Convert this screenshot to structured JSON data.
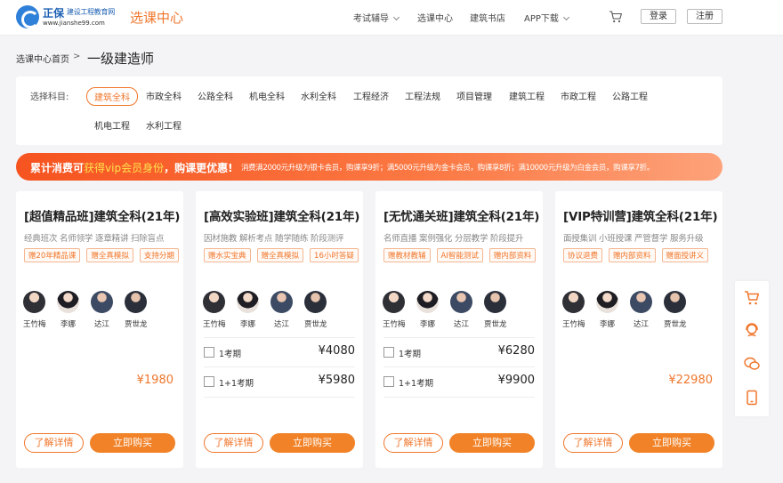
{
  "header": {
    "logo_brand": "正保",
    "logo_tagline": "建设工程教育网",
    "logo_url": "www.jianshe99.com",
    "section_title": "选课中心",
    "nav": [
      {
        "label": "考试辅导",
        "has_dropdown": true
      },
      {
        "label": "选课中心",
        "has_dropdown": false
      },
      {
        "label": "建筑书店",
        "has_dropdown": false
      },
      {
        "label": "APP下载",
        "has_dropdown": true
      }
    ],
    "login_label": "登录",
    "register_label": "注册"
  },
  "breadcrumb": {
    "home": "选课中心首页",
    "separator": ">",
    "current": "一级建造师"
  },
  "subjects": {
    "label": "选择科目:",
    "items": [
      "建筑全科",
      "市政全科",
      "公路全科",
      "机电全科",
      "水利全科",
      "工程经济",
      "工程法规",
      "项目管理",
      "建筑工程",
      "市政工程",
      "公路工程",
      "机电工程",
      "水利工程"
    ],
    "selected": "建筑全科"
  },
  "banner": {
    "main_prefix": "累计消费可",
    "main_highlight": "获得vip会员身份",
    "main_suffix": "，购课更优惠!",
    "sub": "消费满2000元升级为银卡会员，购课享9折；满5000元升级为金卡会员，购课享8折；满10000元升级为白金会员，购课享7折。"
  },
  "cards": [
    {
      "title": "[超值精品班]建筑全科(21年)",
      "desc": "经典班次 名师领学 逐章精讲 扫除盲点",
      "tags": [
        "赠20年精品课",
        "赠全真模拟",
        "支持分期"
      ],
      "teachers": [
        "王竹梅",
        "李娜",
        "达江",
        "贾世龙"
      ],
      "price": "¥1980",
      "options": [],
      "detail_label": "了解详情",
      "buy_label": "立即购买"
    },
    {
      "title": "[高效实验班]建筑全科(21年)",
      "desc": "因材施教 解析考点 随学随练 阶段测评",
      "tags": [
        "赠水实宝典",
        "赠全真模拟",
        "16小时答疑"
      ],
      "teachers": [
        "王竹梅",
        "李娜",
        "达江",
        "贾世龙"
      ],
      "price": "",
      "options": [
        {
          "label": "1考期",
          "price": "¥4080"
        },
        {
          "label": "1+1考期",
          "price": "¥5980"
        }
      ],
      "detail_label": "了解详情",
      "buy_label": "立即购买"
    },
    {
      "title": "[无忧通关班]建筑全科(21年)",
      "desc": "名师直播 案例强化 分层教学 阶段提升",
      "tags": [
        "赠教材教辅",
        "AI智能测试",
        "赠内部资料"
      ],
      "teachers": [
        "王竹梅",
        "李娜",
        "达江",
        "贾世龙"
      ],
      "price": "",
      "options": [
        {
          "label": "1考期",
          "price": "¥6280"
        },
        {
          "label": "1+1考期",
          "price": "¥9900"
        }
      ],
      "detail_label": "了解详情",
      "buy_label": "立即购买"
    },
    {
      "title": "[VIP特训营]建筑全科(21年)",
      "desc": "面授集训 小班授课 严管督学 服务升级",
      "tags": [
        "协议退费",
        "赠内部资料",
        "赠面授讲义"
      ],
      "teachers": [
        "王竹梅",
        "李娜",
        "达江",
        "贾世龙"
      ],
      "price": "¥22980",
      "options": [],
      "detail_label": "了解详情",
      "buy_label": "立即购买"
    }
  ],
  "sidebar": {
    "icons": [
      "cart-icon",
      "customer-service-icon",
      "wechat-icon",
      "mobile-icon"
    ]
  },
  "colors": {
    "accent": "#f0762b",
    "brand_blue": "#2f80d8",
    "banner_start": "#f6531f",
    "banner_end": "#fda27a"
  }
}
